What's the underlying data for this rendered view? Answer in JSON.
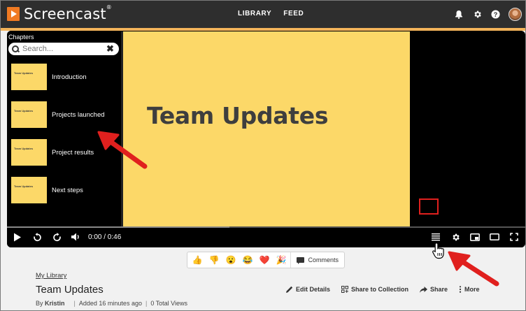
{
  "app": {
    "name": "Screencast",
    "trademark": "®"
  },
  "nav": {
    "library": "LIBRARY",
    "feed": "FEED"
  },
  "top_icons": [
    "bell-icon",
    "gear-icon",
    "help-icon"
  ],
  "player": {
    "slide_title": "Team Updates",
    "chapters_title": "Chapters",
    "search_placeholder": "Search...",
    "chapters": [
      {
        "thumb_text": "Team Updates",
        "label": "Introduction"
      },
      {
        "thumb_text": "Team Updates",
        "label": "Projects launched"
      },
      {
        "thumb_text": "Team Updates",
        "label": "Project results"
      },
      {
        "thumb_text": "Team Updates",
        "label": "Next steps"
      }
    ],
    "time": "0:00 / 0:46"
  },
  "reactions": [
    "👍",
    "👎",
    "😮",
    "😂",
    "❤️",
    "🎉"
  ],
  "comments_label": "Comments",
  "library_link": "My Library",
  "video_title": "Team Updates",
  "meta": {
    "by": "By",
    "author": "Kristin",
    "added": "Added 16 minutes ago",
    "views": "0 Total Views"
  },
  "actions": {
    "edit": "Edit Details",
    "share_collection": "Share to Collection",
    "share": "Share",
    "more": "More"
  },
  "colors": {
    "brand": "#f07a22",
    "slide": "#fcd868",
    "annotation": "#e0201e"
  }
}
